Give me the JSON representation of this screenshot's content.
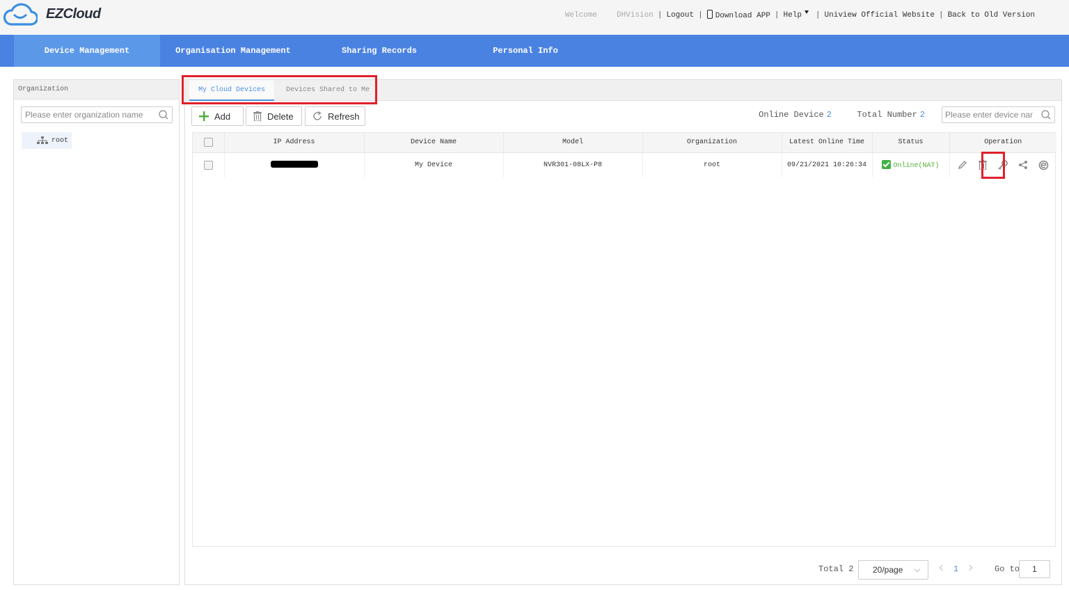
{
  "app": {
    "brand": "EZCloud"
  },
  "top_links": {
    "welcome": "Welcome",
    "username": "DHVision",
    "logout": "Logout",
    "download_app": "Download APP",
    "help": "Help",
    "official_site": "Uniview Official Website",
    "old_version": "Back to Old Version"
  },
  "nav": {
    "items": [
      {
        "label": "Device Management",
        "active": true
      },
      {
        "label": "Organisation Management"
      },
      {
        "label": "Sharing Records"
      },
      {
        "label": "Personal Info"
      }
    ]
  },
  "left_panel": {
    "title": "Organization",
    "search_placeholder": "Please enter organization name",
    "tree_root": "root"
  },
  "tabs": [
    {
      "label": "My Cloud Devices",
      "active": true
    },
    {
      "label": "Devices Shared to Me"
    }
  ],
  "toolbar": {
    "add": "Add",
    "delete": "Delete",
    "refresh": "Refresh",
    "online_label": "Online Device",
    "online_count": "2",
    "total_label": "Total Number",
    "total_count": "2",
    "search_placeholder": "Please enter device name"
  },
  "table": {
    "columns": [
      "IP Address",
      "Device Name",
      "Model",
      "Organization",
      "Latest Online Time",
      "Status",
      "Operation"
    ],
    "rows": [
      {
        "ip": "",
        "name": "My Device",
        "model": "NVR301-08LX-P8",
        "organization": "root",
        "latest_online": "09/21/2021 10:26:34",
        "status": "Online(NAT)"
      }
    ]
  },
  "pagination": {
    "total": "Total 2",
    "page_size": "20/page",
    "current_page": "1",
    "goto_label": "Go to",
    "goto_value": "1"
  },
  "colors": {
    "nav_bg": "#4a82e2",
    "accent": "#4a90e2",
    "highlight": "#e0202a",
    "online": "#52b035"
  }
}
